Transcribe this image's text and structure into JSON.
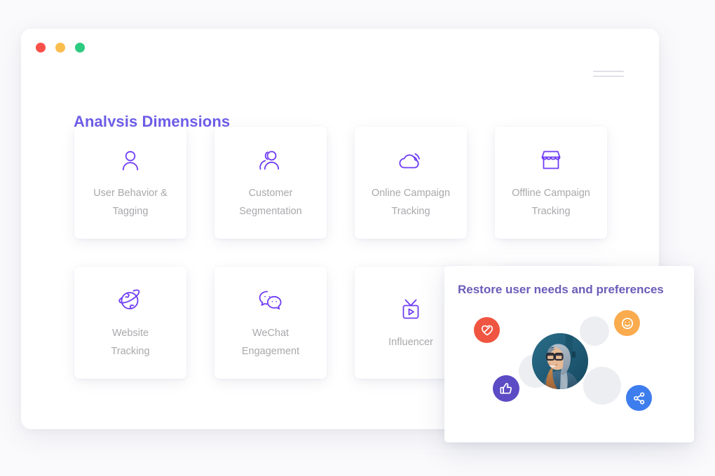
{
  "window": {
    "traffic_lights": [
      {
        "name": "close",
        "color": "#f9504a"
      },
      {
        "name": "minimize",
        "color": "#fbbd4e"
      },
      {
        "name": "maximize",
        "color": "#2dcb80"
      }
    ],
    "handle_icon": "menu-handle-icon"
  },
  "header": {
    "title": "Analysis Dimensions",
    "title_color": "#6d5de8"
  },
  "cards": {
    "icon_color": "#6f3cf5",
    "label_color": "#a9a9ad",
    "rows": [
      [
        {
          "icon": "user-icon",
          "label": "User Behavior &\nTagging"
        },
        {
          "icon": "users-group-icon",
          "label": "Customer\nSegmentation"
        },
        {
          "icon": "cloud-signal-icon",
          "label": "Online Campaign\nTracking"
        },
        {
          "icon": "storefront-icon",
          "label": "Offline Campaign\nTracking"
        }
      ],
      [
        {
          "icon": "globe-orbit-icon",
          "label": "Website\nTracking"
        },
        {
          "icon": "wechat-bubbles-icon",
          "label": "WeChat\nEngagement"
        },
        {
          "icon": "tv-play-icon",
          "label": "Influencer"
        },
        {
          "icon": "",
          "label": ""
        }
      ]
    ]
  },
  "popup": {
    "title": "Restore user needs and preferences",
    "title_color": "#6b5cb9",
    "avatar": {
      "name": "user-avatar",
      "alt": "Smiling woman with glasses wearing a grey hood"
    },
    "bubbles": [
      {
        "icon": "heart-pulse-icon",
        "name": "like-heart-button",
        "color": "#ef5540"
      },
      {
        "icon": "smiley-face-icon",
        "name": "smiley-reaction-button",
        "color": "#f9ab4e"
      },
      {
        "icon": "thumbs-up-icon",
        "name": "thumbs-up-button",
        "color": "#5b4bc4"
      },
      {
        "icon": "share-nodes-icon",
        "name": "share-button",
        "color": "#3d7dee"
      }
    ]
  }
}
